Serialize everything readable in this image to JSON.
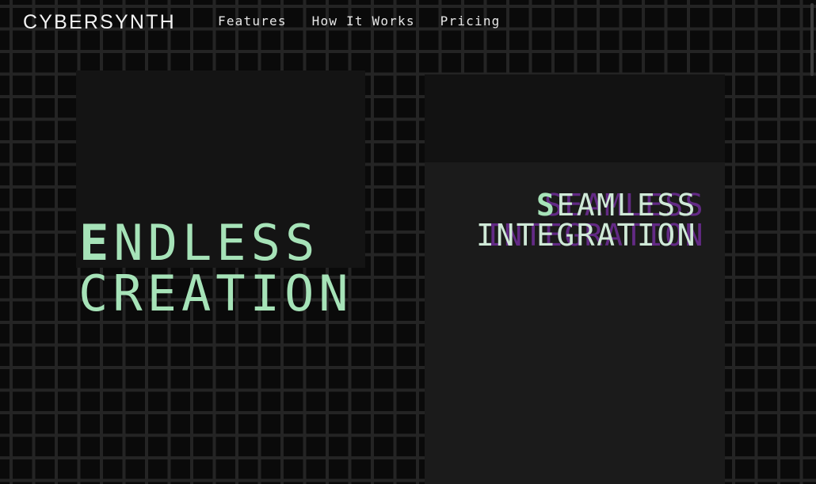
{
  "brand": {
    "name": "CYBERSYNTH"
  },
  "nav": {
    "links": [
      {
        "label": "Features"
      },
      {
        "label": "How It Works"
      },
      {
        "label": "Pricing"
      }
    ]
  },
  "hero_left": {
    "line1_first": "E",
    "line1_rest": "NDLESS",
    "line2": "CREATION"
  },
  "hero_right": {
    "line1_first": "S",
    "line1_rest": "EAMLESS",
    "line1_ghost": "SEAMLESS",
    "line2": "INTEGRATION",
    "line2_ghost": "INTEGRATION"
  },
  "colors": {
    "accent_green": "#a6e3b8",
    "accent_purple": "#6b2c91",
    "background": "#0b0b0b"
  }
}
